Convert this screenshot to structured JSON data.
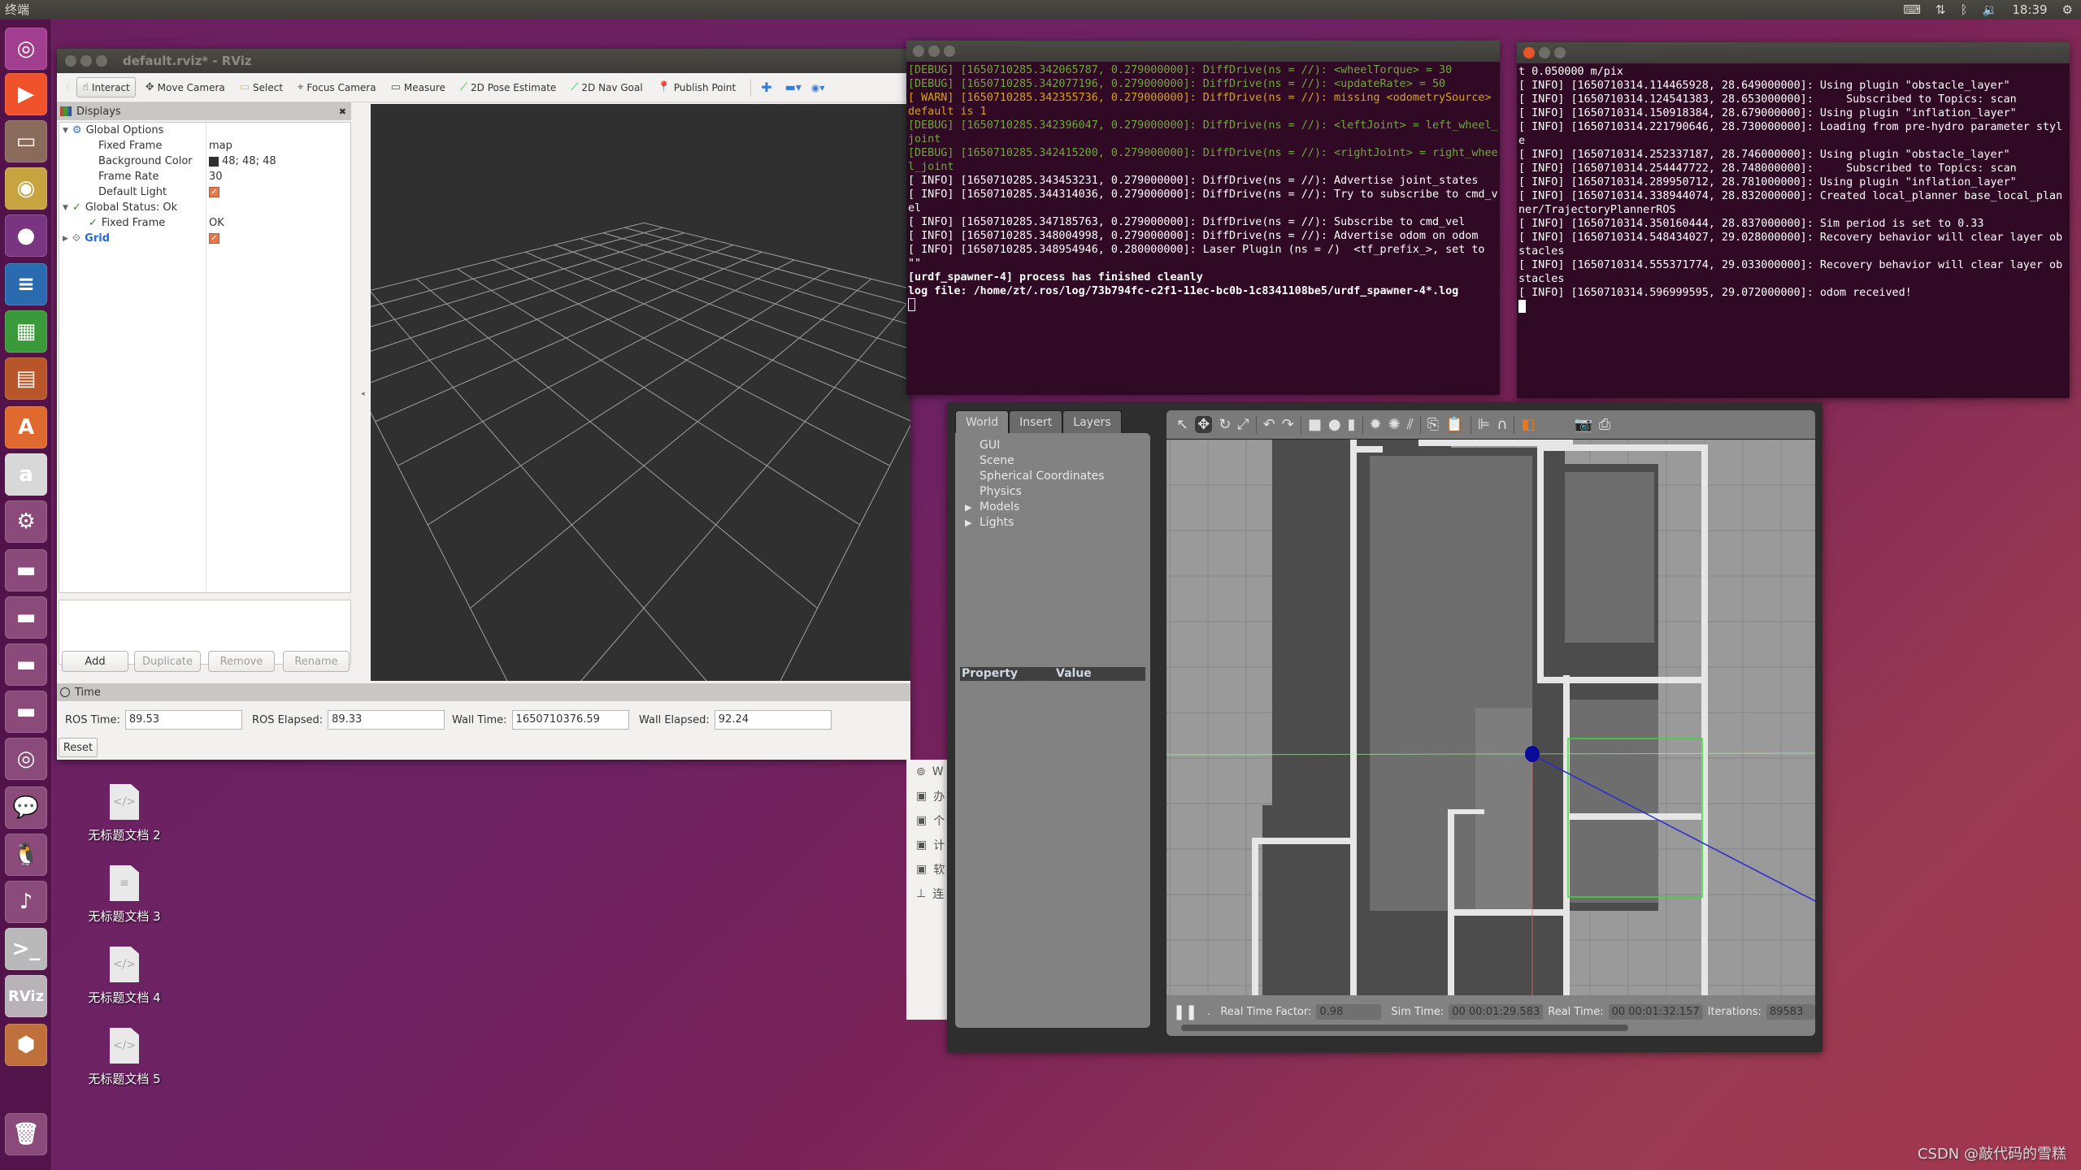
{
  "topbar": {
    "title": "终端",
    "tray": {
      "keyboard_icon": "keyboard-icon",
      "network_icon": "network-updown-icon",
      "bluetooth_icon": "bluetooth-icon",
      "volume_icon": "volume-icon",
      "clock": "18:39",
      "power_icon": "power-gear-icon"
    }
  },
  "launcher": {
    "items": [
      {
        "name": "ubuntu-dash",
        "glyph": "◎",
        "color": "#a23e8f"
      },
      {
        "name": "media-player",
        "glyph": "▶",
        "color": "#f0522b"
      },
      {
        "name": "files",
        "glyph": "▭",
        "color": "#8a6a5a"
      },
      {
        "name": "chrome",
        "glyph": "◉",
        "color": "#c8a440"
      },
      {
        "name": "firefox",
        "glyph": "●",
        "color": "#7a3580"
      },
      {
        "name": "libreoffice-writer",
        "glyph": "≡",
        "color": "#2a6bb0"
      },
      {
        "name": "libreoffice-calc",
        "glyph": "▦",
        "color": "#3a9a3a"
      },
      {
        "name": "libreoffice-impress",
        "glyph": "▤",
        "color": "#b8562a"
      },
      {
        "name": "software-center",
        "glyph": "A",
        "color": "#e0692f"
      },
      {
        "name": "amazon",
        "glyph": "a",
        "color": "#d8d8d8"
      },
      {
        "name": "system-settings",
        "glyph": "⚙",
        "color": "#8a4a7a"
      },
      {
        "name": "drive-1",
        "glyph": "▬",
        "color": "#8a4a7a"
      },
      {
        "name": "drive-2",
        "glyph": "▬",
        "color": "#8a4a7a"
      },
      {
        "name": "drive-3",
        "glyph": "▬",
        "color": "#8a4a7a"
      },
      {
        "name": "drive-4",
        "glyph": "▬",
        "color": "#8a4a7a"
      },
      {
        "name": "optical-disc",
        "glyph": "◎",
        "color": "#8a4a7a"
      },
      {
        "name": "wechat",
        "glyph": "💬",
        "color": "#8a4a7a"
      },
      {
        "name": "qq",
        "glyph": "🐧",
        "color": "#8a4a7a"
      },
      {
        "name": "qq-music",
        "glyph": "♪",
        "color": "#8a4a7a"
      },
      {
        "name": "terminal",
        "glyph": ">_",
        "color": "#b9b9b9"
      },
      {
        "name": "rviz",
        "glyph": "RViz",
        "color": "#b9b3b9"
      },
      {
        "name": "gazebo",
        "glyph": "⬢",
        "color": "#c0703a"
      },
      {
        "name": "trash",
        "glyph": "🗑",
        "color": "#8a4a7a"
      }
    ]
  },
  "desktop": {
    "icons": [
      {
        "label": "无标题文档 2",
        "kind": "code"
      },
      {
        "label": "无标题文档 3",
        "kind": "text"
      },
      {
        "label": "无标题文档 4",
        "kind": "code"
      },
      {
        "label": "无标题文档 5",
        "kind": "code"
      }
    ]
  },
  "rviz": {
    "title": "default.rviz* - RViz",
    "toolbar": [
      {
        "label": "Interact",
        "icon": "hand-pointer-icon",
        "active": true
      },
      {
        "label": "Move Camera",
        "icon": "move-camera-icon"
      },
      {
        "label": "Select",
        "icon": "select-box-icon"
      },
      {
        "label": "Focus Camera",
        "icon": "focus-camera-icon"
      },
      {
        "label": "Measure",
        "icon": "ruler-icon"
      },
      {
        "label": "2D Pose Estimate",
        "icon": "green-arrow-icon"
      },
      {
        "label": "2D Nav Goal",
        "icon": "green-arrow-icon"
      },
      {
        "label": "Publish Point",
        "icon": "map-pin-icon"
      }
    ],
    "displays": {
      "title": "Displays",
      "rows": [
        {
          "key": "Global Options",
          "value": "",
          "indent": 0,
          "expander": "▼",
          "icon": "⚙",
          "icon_color": "#3a6fcf"
        },
        {
          "key": "Fixed Frame",
          "value": "map",
          "indent": 1
        },
        {
          "key": "Background Color",
          "value": "48; 48; 48",
          "indent": 1,
          "swatch": true
        },
        {
          "key": "Frame Rate",
          "value": "30",
          "indent": 1
        },
        {
          "key": "Default Light",
          "value": "",
          "indent": 1,
          "checked": true
        },
        {
          "key": "Global Status: Ok",
          "value": "",
          "indent": 0,
          "expander": "▼",
          "icon": "✓",
          "icon_color": "#2a8a2a"
        },
        {
          "key": "Fixed Frame",
          "value": "OK",
          "indent": 1,
          "icon": "✓",
          "icon_color": "#2a8a2a"
        },
        {
          "key": "Grid",
          "value": "",
          "indent": 0,
          "expander": "▶",
          "icon": "⟐",
          "icon_color": "#555",
          "checked": true,
          "highlight": true
        }
      ],
      "buttons": {
        "add": "Add",
        "duplicate": "Duplicate",
        "remove": "Remove",
        "rename": "Rename"
      }
    },
    "time": {
      "title": "Time",
      "ros_time_label": "ROS Time:",
      "ros_time": "89.53",
      "ros_elapsed_label": "ROS Elapsed:",
      "ros_elapsed": "89.33",
      "wall_time_label": "Wall Time:",
      "wall_time": "1650710376.59",
      "wall_elapsed_label": "Wall Elapsed:",
      "wall_elapsed": "92.24",
      "reset": "Reset"
    }
  },
  "terminal1": {
    "lines": [
      {
        "level": "debug",
        "text": "[DEBUG] [1650710285.342065787, 0.279000000]: DiffDrive(ns = //): <wheelTorque> = 30"
      },
      {
        "level": "debug",
        "text": "[DEBUG] [1650710285.342077196, 0.279000000]: DiffDrive(ns = //): <updateRate> = 50"
      },
      {
        "level": "warn",
        "text": "[ WARN] [1650710285.342355736, 0.279000000]: DiffDrive(ns = //): missing <odometrySource> default is 1"
      },
      {
        "level": "debug",
        "text": "[DEBUG] [1650710285.342396047, 0.279000000]: DiffDrive(ns = //): <leftJoint> = left_wheel_joint"
      },
      {
        "level": "debug",
        "text": "[DEBUG] [1650710285.342415200, 0.279000000]: DiffDrive(ns = //): <rightJoint> = right_wheel_joint"
      },
      {
        "level": "info",
        "text": "[ INFO] [1650710285.343453231, 0.279000000]: DiffDrive(ns = //): Advertise joint_states"
      },
      {
        "level": "info",
        "text": "[ INFO] [1650710285.344314036, 0.279000000]: DiffDrive(ns = //): Try to subscribe to cmd_vel"
      },
      {
        "level": "info",
        "text": "[ INFO] [1650710285.347185763, 0.279000000]: DiffDrive(ns = //): Subscribe to cmd_vel"
      },
      {
        "level": "info",
        "text": "[ INFO] [1650710285.348004998, 0.279000000]: DiffDrive(ns = //): Advertise odom on odom"
      },
      {
        "level": "info",
        "text": "[ INFO] [1650710285.348954946, 0.280000000]: Laser Plugin (ns = /)  <tf_prefix_>, set to \"\""
      },
      {
        "level": "bold",
        "text": "[urdf_spawner-4] process has finished cleanly"
      },
      {
        "level": "bold",
        "text": "log file: /home/zt/.ros/log/73b794fc-c2f1-11ec-bc0b-1c8341108be5/urdf_spawner-4*.log"
      }
    ]
  },
  "terminal2": {
    "lines": [
      {
        "level": "info",
        "text": "t 0.050000 m/pix"
      },
      {
        "level": "info",
        "text": "[ INFO] [1650710314.114465928, 28.649000000]: Using plugin \"obstacle_layer\""
      },
      {
        "level": "info",
        "text": "[ INFO] [1650710314.124541383, 28.653000000]:     Subscribed to Topics: scan"
      },
      {
        "level": "info",
        "text": "[ INFO] [1650710314.150918384, 28.679000000]: Using plugin \"inflation_layer\""
      },
      {
        "level": "info",
        "text": "[ INFO] [1650710314.221790646, 28.730000000]: Loading from pre-hydro parameter style"
      },
      {
        "level": "info",
        "text": "[ INFO] [1650710314.252337187, 28.746000000]: Using plugin \"obstacle_layer\""
      },
      {
        "level": "info",
        "text": "[ INFO] [1650710314.254447722, 28.748000000]:     Subscribed to Topics: scan"
      },
      {
        "level": "info",
        "text": "[ INFO] [1650710314.289950712, 28.781000000]: Using plugin \"inflation_layer\""
      },
      {
        "level": "info",
        "text": "[ INFO] [1650710314.338944074, 28.832000000]: Created local_planner base_local_planner/TrajectoryPlannerROS"
      },
      {
        "level": "info",
        "text": "[ INFO] [1650710314.350160444, 28.837000000]: Sim period is set to 0.33"
      },
      {
        "level": "info",
        "text": "[ INFO] [1650710314.548434027, 29.028000000]: Recovery behavior will clear layer obstacles"
      },
      {
        "level": "info",
        "text": "[ INFO] [1650710314.555371774, 29.033000000]: Recovery behavior will clear layer obstacles"
      },
      {
        "level": "info",
        "text": "[ INFO] [1650710314.596999595, 29.072000000]: odom received!"
      }
    ]
  },
  "behind_window": {
    "items": [
      {
        "icon": "disc-icon",
        "label": "W"
      },
      {
        "icon": "drive-icon",
        "label": "办"
      },
      {
        "icon": "drive-icon",
        "label": "个"
      },
      {
        "icon": "drive-icon",
        "label": "计"
      },
      {
        "icon": "drive-icon",
        "label": "软"
      },
      {
        "icon": "network-icon",
        "label": "连"
      }
    ]
  },
  "gazebo": {
    "tabs": [
      {
        "label": "World",
        "active": true
      },
      {
        "label": "Insert"
      },
      {
        "label": "Layers"
      }
    ],
    "world_items": [
      {
        "label": "GUI"
      },
      {
        "label": "Scene"
      },
      {
        "label": "Spherical Coordinates"
      },
      {
        "label": "Physics"
      },
      {
        "label": "Models",
        "expandable": true
      },
      {
        "label": "Lights",
        "expandable": true
      }
    ],
    "property_header": "Property",
    "value_header": "Value",
    "toolbar": [
      "select-arrow-icon",
      "translate-icon",
      "rotate-icon",
      "scale-icon",
      "undo-icon",
      "redo-icon",
      "box-icon",
      "sphere-icon",
      "cylinder-icon",
      "point-light-icon",
      "spot-light-icon",
      "directional-light-icon",
      "copy-icon",
      "paste-icon",
      "align-icon",
      "snap-magnet-icon",
      "view-angle-icon",
      "screenshot-camera-icon",
      "log-icon"
    ],
    "status": {
      "real_time_factor_label": "Real Time Factor:",
      "real_time_factor": "0.98",
      "sim_time_label": "Sim Time:",
      "sim_time": "00 00:01:29.583",
      "real_time_label": "Real Time:",
      "real_time": "00 00:01:32.157",
      "iterations_label": "Iterations:",
      "iterations": "89583"
    }
  },
  "watermark": "CSDN @敲代码的雪糕"
}
